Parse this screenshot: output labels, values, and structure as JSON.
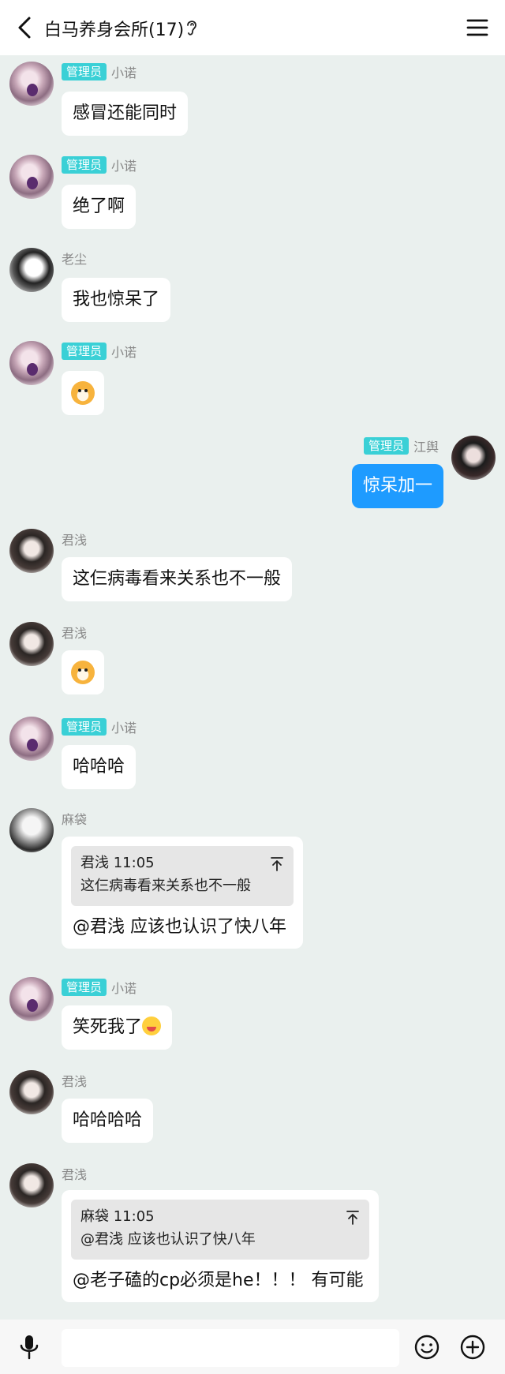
{
  "header": {
    "title": "白马养身会所(17)",
    "back_icon": "chevron-left-icon",
    "ear_icon": "ear-icon",
    "menu_icon": "hamburger-menu-icon"
  },
  "colors": {
    "admin_badge": "#3ad0d6",
    "my_bubble": "#1e9bff",
    "background": "#eaf0ee"
  },
  "messages": [
    {
      "sender": "小诺",
      "badge": "管理员",
      "text": "感冒还能同时"
    },
    {
      "sender": "小诺",
      "badge": "管理员",
      "text": "绝了啊"
    },
    {
      "sender": "老尘",
      "badge": "",
      "text": "我也惊呆了"
    },
    {
      "sender": "小诺",
      "badge": "管理员",
      "emoji": "dog-emoji"
    },
    {
      "sender": "江舆",
      "badge": "管理员",
      "text": "惊呆加一",
      "mine": true
    },
    {
      "sender": "君浅",
      "badge": "",
      "text": "这仨病毒看来关系也不一般"
    },
    {
      "sender": "君浅",
      "badge": "",
      "emoji": "dog-emoji"
    },
    {
      "sender": "小诺",
      "badge": "管理员",
      "text": "哈哈哈"
    },
    {
      "sender": "麻袋",
      "badge": "",
      "quote": {
        "head": "君浅 11:05",
        "text": "这仨病毒看来关系也不一般"
      },
      "text": "@君浅 应该也认识了快八年"
    },
    {
      "sender": "小诺",
      "badge": "管理员",
      "text": "笑死我了",
      "emoji": "laughing-face-emoji"
    },
    {
      "sender": "君浅",
      "badge": "",
      "text": "哈哈哈哈"
    },
    {
      "sender": "君浅",
      "badge": "",
      "quote": {
        "head": "麻袋 11:05",
        "text": "@君浅 应该也认识了快八年"
      },
      "text": "@老子磕的cp必须是he！！！ 有可能"
    }
  ],
  "bottom": {
    "mic_icon": "microphone-icon",
    "emoji_icon": "smiley-icon",
    "plus_icon": "plus-circle-icon",
    "input_placeholder": ""
  }
}
